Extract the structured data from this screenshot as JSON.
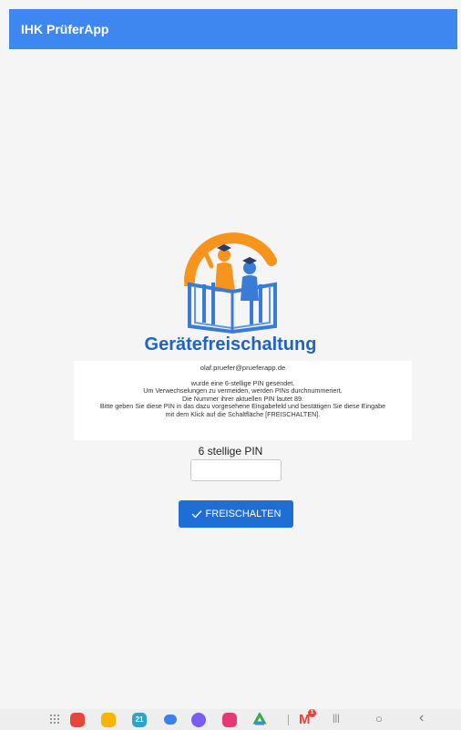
{
  "app": {
    "title": "IHK PrüferApp"
  },
  "main": {
    "heading": "Gerätefreischaltung",
    "info": {
      "email": "olaf.pruefer@prueferapp.de",
      "lines": [
        "wurde eine 6-stellige PIN gesendet.",
        "Um Verwechselungen zu vermeiden, werden PINs durchnummeriert.",
        "Die Nummer ihrer aktuellen PIN lautet 89.",
        "Bitte geben Sie diese PIN in das dazu vorgesehene Eingabefeld und bestätigen Sie diese Eingabe",
        "mit dem Klick auf die Schaltfläche [FREISCHALTEN]."
      ]
    },
    "pin": {
      "label": "6 stellige PIN",
      "value": "",
      "placeholder": ""
    },
    "button": {
      "label": "FREISCHALTEN",
      "icon": "check-icon"
    }
  },
  "taskbar": {
    "apps": [
      {
        "name": "apps-grid-icon"
      },
      {
        "name": "red-app-icon",
        "color": "#e8453c"
      },
      {
        "name": "yellow-folder-icon",
        "color": "#f7b500"
      },
      {
        "name": "calendar-icon",
        "color": "#2fa4c9",
        "text": "21"
      },
      {
        "name": "chat-icon",
        "color": "#3b82e6"
      },
      {
        "name": "compass-icon",
        "color": "#7b5cf0"
      },
      {
        "name": "camera-icon",
        "color": "#e53975"
      },
      {
        "name": "drive-icon",
        "color": "#34a853"
      },
      {
        "name": "gmail-icon",
        "color": "#ea4335",
        "badge": "1"
      }
    ],
    "nav": {
      "recent": "|||",
      "home": "○",
      "back": "‹"
    }
  },
  "colors": {
    "appbar": "#3e87f1",
    "heading": "#1f64c2",
    "button": "#1e6ed6",
    "logo_orange": "#f7941d",
    "logo_blue": "#3a7bd5"
  }
}
